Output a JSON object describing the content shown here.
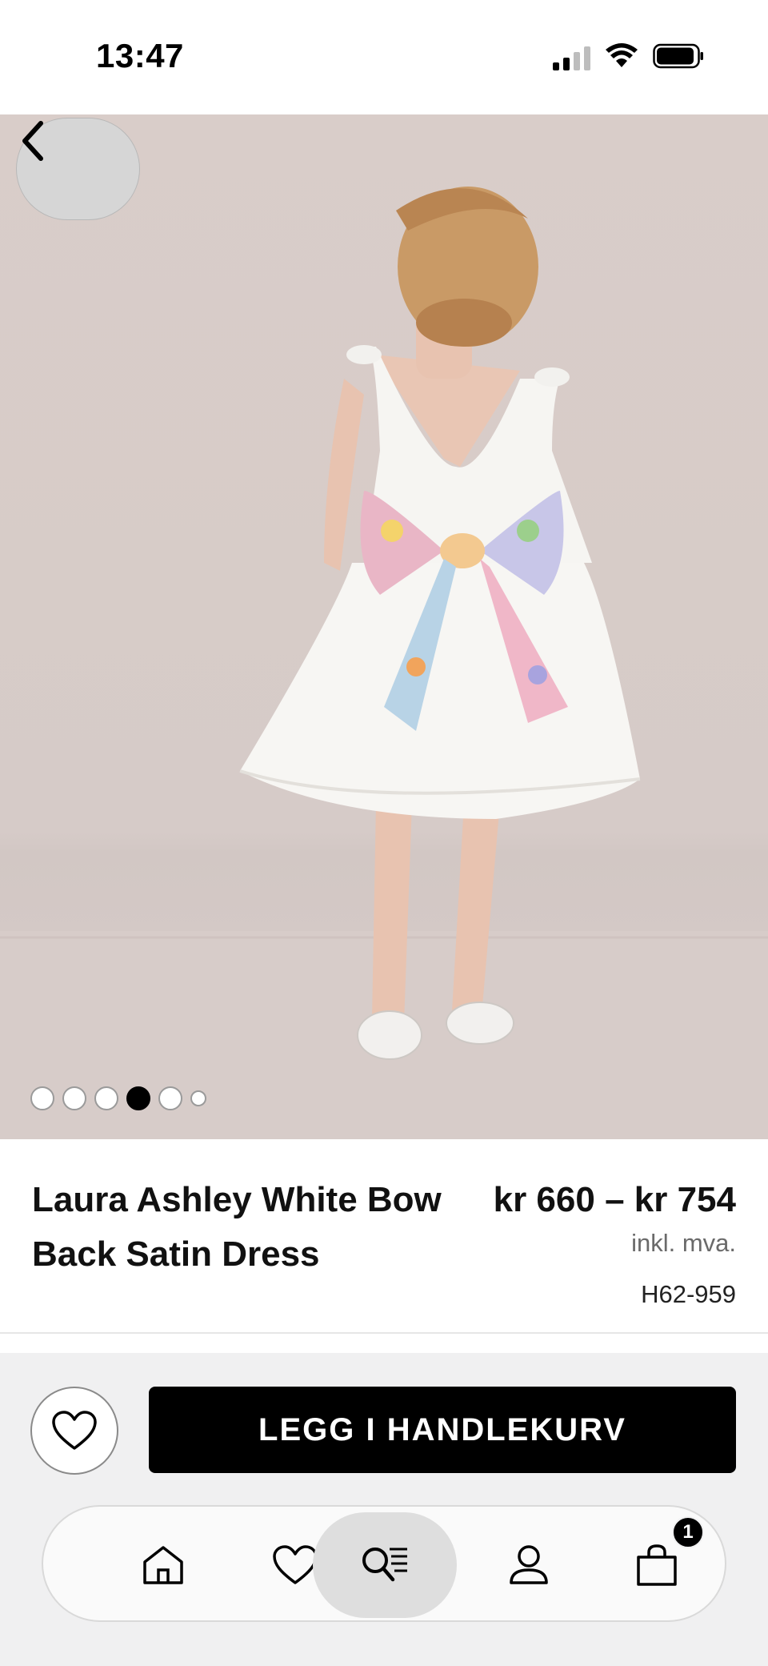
{
  "status_bar": {
    "time": "13:47"
  },
  "gallery": {
    "image_count": 6,
    "active_index": 3
  },
  "product": {
    "title": "Laura Ashley White Bow Back Satin Dress",
    "price": "kr 660 – kr 754",
    "vat_note": "inkl. mva.",
    "sku": "H62-959"
  },
  "actions": {
    "add_to_cart_label": "LEGG I HANDLEKURV"
  },
  "tabbar": {
    "items": [
      "home-icon",
      "heart-icon",
      "search-icon",
      "user-icon",
      "bag-icon"
    ],
    "active": "search-icon",
    "cart_count": "1"
  },
  "colors": {
    "background_photo": "#d8cdca",
    "button": "#000000",
    "tabbar_bg": "#fafafa"
  }
}
